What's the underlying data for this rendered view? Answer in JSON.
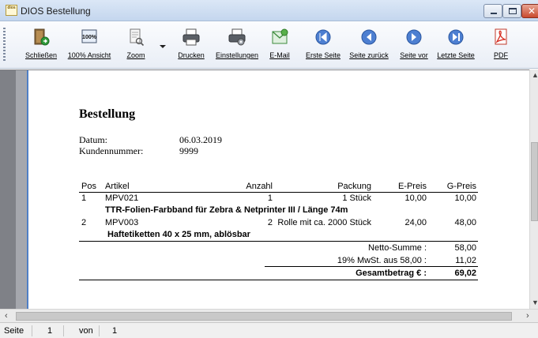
{
  "window": {
    "title": "DIOS Bestellung",
    "icon_text": "dios"
  },
  "toolbar": {
    "buttons": [
      {
        "label": "Schließen",
        "icon": "exit-door-icon"
      },
      {
        "label": "100% Ansicht",
        "icon": "zoom-100-icon"
      },
      {
        "label": "Zoom",
        "icon": "zoom-page-icon"
      },
      {
        "label": "Drucken",
        "icon": "printer-icon"
      },
      {
        "label": "Einstellungen",
        "icon": "printer-settings-icon"
      },
      {
        "label": "E-Mail",
        "icon": "email-icon"
      },
      {
        "label": "Erste Seite",
        "icon": "first-page-icon"
      },
      {
        "label": "Seite zurück",
        "icon": "previous-page-icon"
      },
      {
        "label": "Seite vor",
        "icon": "next-page-icon"
      },
      {
        "label": "Letzte Seite",
        "icon": "last-page-icon"
      },
      {
        "label": "PDF",
        "icon": "pdf-icon"
      }
    ]
  },
  "document": {
    "title": "Bestellung",
    "date_label": "Datum:",
    "date_value": "06.03.2019",
    "customer_label": "Kundennummer:",
    "customer_value": "9999",
    "columns": [
      "Pos",
      "Artikel",
      "Anzahl",
      "Packung",
      "E-Preis",
      "G-Preis"
    ],
    "items": [
      {
        "pos": "1",
        "artikel": "MPV021",
        "anzahl": "1",
        "packung": "1 Stück",
        "epreis": "10,00",
        "gpreis": "10,00",
        "description": "TTR-Folien-Farbband für Zebra & Netprinter III / Länge 74m"
      },
      {
        "pos": "2",
        "artikel": "MPV003",
        "anzahl": "2",
        "packung": "Rolle mit ca. 2000 Stück",
        "epreis": "24,00",
        "gpreis": "48,00",
        "description": "Haftetiketten 40 x 25 mm, ablösbar"
      }
    ],
    "totals": {
      "net_label": "Netto-Summe :",
      "net_value": "58,00",
      "vat_label": "19% MwSt. aus 58,00 :",
      "vat_value": "11,02",
      "gross_label": "Gesamtbetrag € :",
      "gross_value": "69,02"
    }
  },
  "status": {
    "page_label": "Seite",
    "page_value": "1",
    "of_label": "von",
    "of_value": "1"
  }
}
